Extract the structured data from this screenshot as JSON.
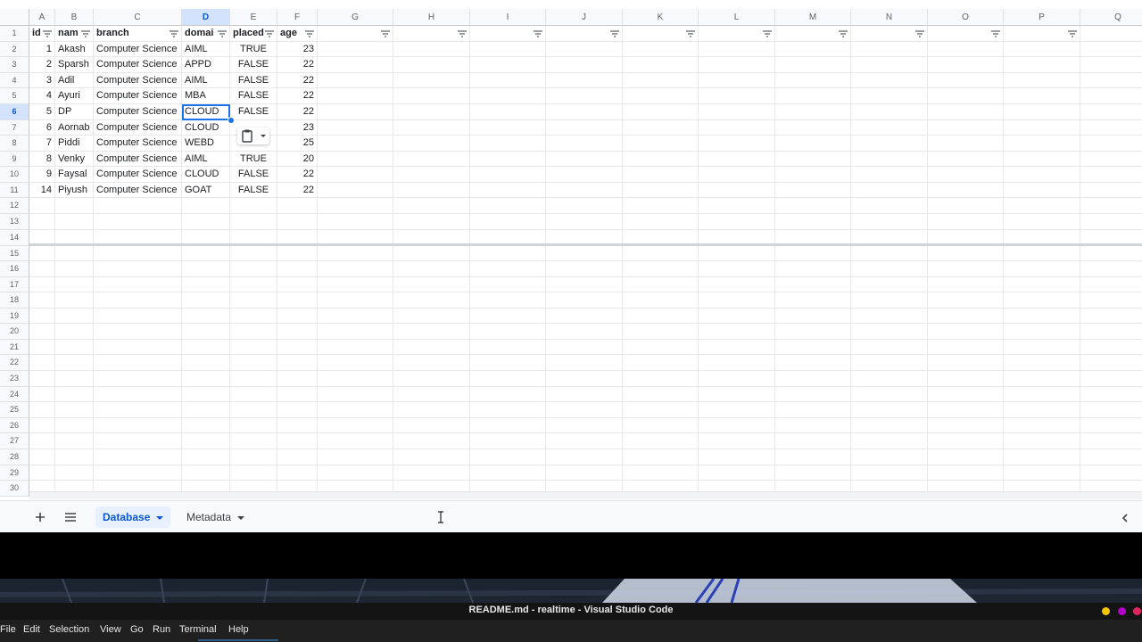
{
  "sheet": {
    "columns": [
      "A",
      "B",
      "C",
      "D",
      "E",
      "F",
      "G",
      "H",
      "I",
      "J",
      "K",
      "L",
      "M",
      "N",
      "O",
      "P",
      "Q"
    ],
    "selected_column": "D",
    "selected_row": "6",
    "row_numbers": [
      "1",
      "2",
      "3",
      "4",
      "5",
      "6",
      "7",
      "8",
      "9",
      "10",
      "11",
      "12",
      "13",
      "14",
      "15",
      "16",
      "17",
      "18",
      "19",
      "20",
      "21",
      "22",
      "23",
      "24",
      "25",
      "26",
      "27",
      "28",
      "29",
      "30"
    ],
    "headers": [
      "id",
      "nam",
      "branch",
      "domai",
      "placed",
      "age"
    ],
    "rows": [
      [
        "1",
        "Akash",
        "Computer Science",
        "AIML",
        "TRUE",
        "23"
      ],
      [
        "2",
        "Sparsh",
        "Computer Science",
        "APPD",
        "FALSE",
        "22"
      ],
      [
        "3",
        "Adil",
        "Computer Science",
        "AIML",
        "FALSE",
        "22"
      ],
      [
        "4",
        "Ayuri",
        "Computer Science",
        "MBA",
        "FALSE",
        "22"
      ],
      [
        "5",
        "DP",
        "Computer Science",
        "CLOUD",
        "FALSE",
        "22"
      ],
      [
        "6",
        "Aornab",
        "Computer Science",
        "CLOUD",
        "",
        "23"
      ],
      [
        "7",
        "Piddi",
        "Computer Science",
        "WEBD",
        "",
        "25"
      ],
      [
        "8",
        "Venky",
        "Computer Science",
        "AIML",
        "TRUE",
        "20"
      ],
      [
        "9",
        "Faysal",
        "Computer Science",
        "CLOUD",
        "FALSE",
        "22"
      ],
      [
        "14",
        "Piyush",
        "Computer Science",
        "GOAT",
        "FALSE",
        "22"
      ]
    ],
    "filter_icon": "filter-icon",
    "paste_icon": "clipboard-paste-icon"
  },
  "tabs": {
    "add_icon": "plus-icon",
    "list_icon": "sheet-list-icon",
    "items": [
      {
        "label": "Database",
        "active": true
      },
      {
        "label": "Metadata",
        "active": false
      }
    ],
    "collapse_icon": "chevron-left-icon"
  },
  "vscode": {
    "title": "README.md - realtime - Visual Studio Code",
    "menu": [
      "File",
      "Edit",
      "Selection",
      "View",
      "Go",
      "Run",
      "Terminal",
      "Help"
    ],
    "dot_colors": [
      "#f2c500",
      "#b300c8",
      "#e0245e"
    ]
  },
  "colors": {
    "accent": "#1a73e8",
    "selected_header_bg": "#d3e3fd"
  }
}
